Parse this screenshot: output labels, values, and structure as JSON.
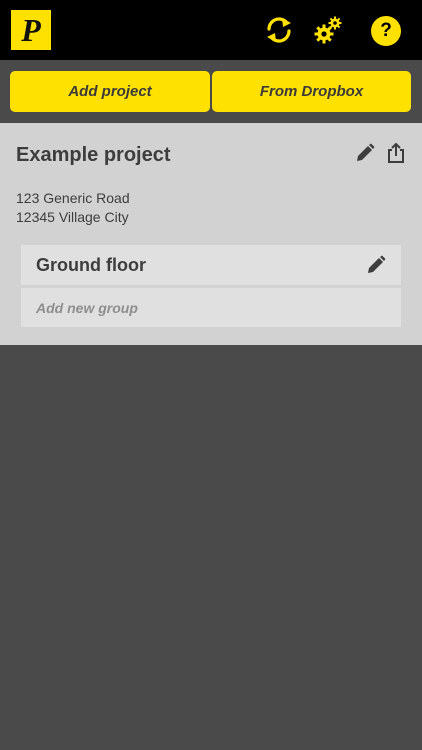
{
  "app": {
    "logo_letter": "P"
  },
  "header": {
    "icons": [
      "sync-icon",
      "settings-icon",
      "help-icon"
    ],
    "help_label": "?"
  },
  "actions": {
    "add_project_label": "Add project",
    "from_dropbox_label": "From Dropbox"
  },
  "project": {
    "title": "Example project",
    "address_line1": "123 Generic Road",
    "address_line2": "12345 Village City",
    "groups": [
      {
        "label": "Ground floor"
      }
    ],
    "add_group_placeholder": "Add new group"
  },
  "colors": {
    "accent": "#ffe100",
    "topbar": "#000000",
    "background": "#4a4a4a",
    "card": "#d2d2d2",
    "row": "#e0e0e0"
  }
}
